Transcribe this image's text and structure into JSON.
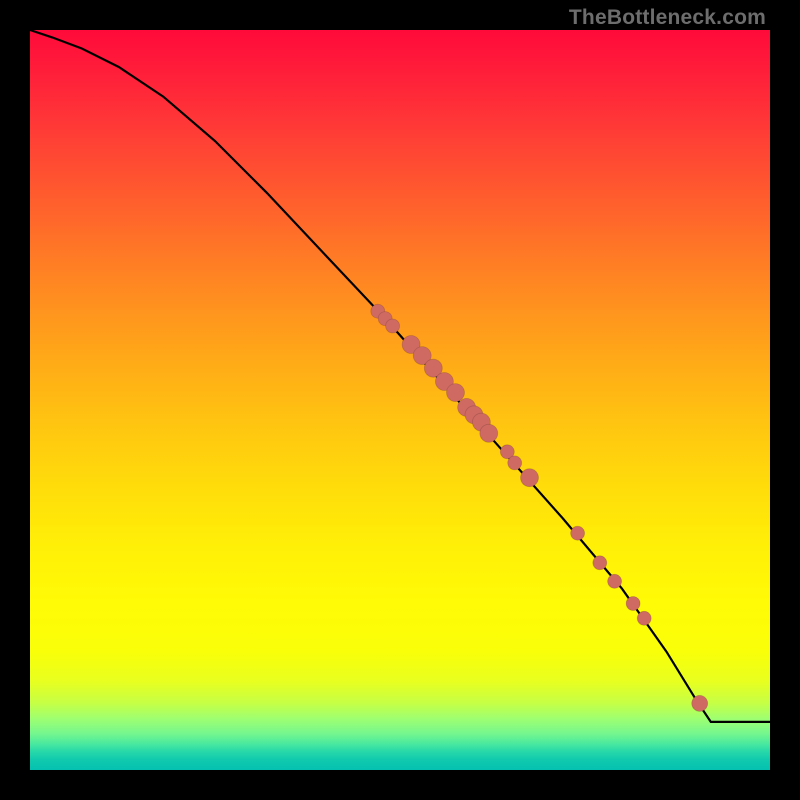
{
  "watermark": "TheBottleneck.com",
  "colors": {
    "point_fill": "#cf6a62",
    "curve_stroke": "#000000"
  },
  "chart_data": {
    "type": "line",
    "title": "",
    "xlabel": "",
    "ylabel": "",
    "xlim": [
      0,
      100
    ],
    "ylim": [
      0,
      100
    ],
    "grid": false,
    "legend": false,
    "series": [
      {
        "name": "curve",
        "kind": "line",
        "x": [
          0,
          3,
          7,
          12,
          18,
          25,
          32,
          40,
          48,
          56,
          64,
          72,
          80,
          86,
          90,
          92,
          100
        ],
        "y": [
          100,
          99,
          97.5,
          95,
          91,
          85,
          78,
          69.5,
          61,
          52,
          43,
          34,
          24.5,
          16,
          9.5,
          6.5,
          6.5
        ]
      },
      {
        "name": "points",
        "kind": "scatter",
        "x": [
          47.0,
          48.0,
          49.0,
          51.5,
          53.0,
          54.5,
          56.0,
          57.5,
          59.0,
          60.0,
          61.0,
          62.0,
          64.5,
          65.5,
          67.5,
          74.0,
          77.0,
          79.0,
          81.5,
          83.0,
          90.5
        ],
        "y": [
          62.0,
          61.0,
          60.0,
          57.5,
          56.0,
          54.3,
          52.5,
          51.0,
          49.0,
          48.0,
          47.0,
          45.5,
          43.0,
          41.5,
          39.5,
          32.0,
          28.0,
          25.5,
          22.5,
          20.5,
          9.0
        ],
        "r": [
          7,
          7,
          7,
          9,
          9,
          9,
          9,
          9,
          9,
          9,
          9,
          9,
          7,
          7,
          9,
          7,
          7,
          7,
          7,
          7,
          8
        ]
      }
    ]
  }
}
